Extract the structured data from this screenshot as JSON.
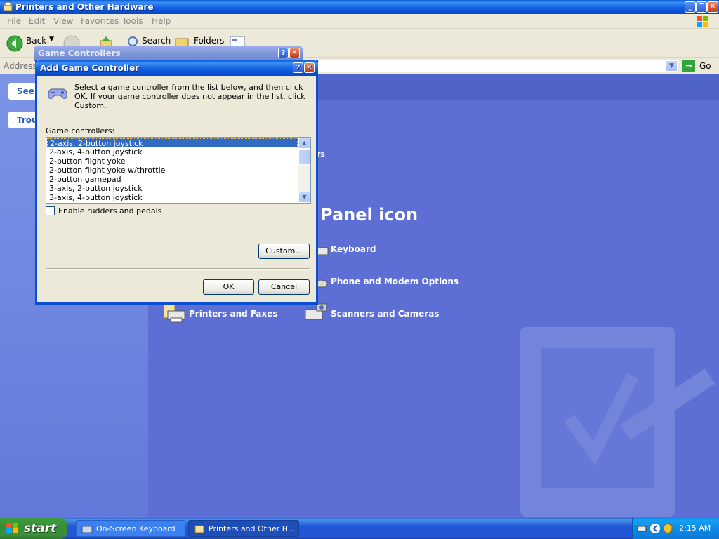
{
  "explorer": {
    "title": "Printers and Other Hardware",
    "menu": [
      "File",
      "Edit",
      "View",
      "Favorites",
      "Tools",
      "Help"
    ],
    "toolbar": {
      "back": "Back",
      "search": "Search",
      "folders": "Folders"
    },
    "address_label": "Address",
    "go_label": "Go"
  },
  "taskpane": {
    "tab1": "See",
    "tab2": "Trou"
  },
  "content": {
    "heading_fragment": "Panel icon",
    "partial_text": "rs",
    "items": [
      "Keyboard",
      "Phone and Modem Options",
      "Printers and Faxes",
      "Scanners and Cameras"
    ]
  },
  "game_controllers": {
    "title": "Game Controllers"
  },
  "add_dialog": {
    "title": "Add Game Controller",
    "instruction": "Select a game controller from the list below, and then click OK.  If your game controller does not appear in the list, click Custom.",
    "list_label": "Game controllers:",
    "list_items": [
      "2-axis, 2-button joystick",
      "2-axis, 4-button joystick",
      "2-button flight yoke",
      "2-button flight yoke w/throttle",
      "2-button gamepad",
      "3-axis, 2-button joystick",
      "3-axis, 4-button joystick"
    ],
    "selected_index": 0,
    "checkbox_label": "Enable rudders and pedals",
    "checkbox_checked": false,
    "custom_button": "Custom...",
    "ok_button": "OK",
    "cancel_button": "Cancel"
  },
  "taskbar": {
    "start": "start",
    "tasks": [
      "On-Screen Keyboard",
      "Printers and Other H..."
    ],
    "time": "2:15 AM"
  },
  "colors": {
    "xp_blue": "#0a5fd8",
    "desktop_panel": "#5d6fd4",
    "selection": "#316ac5"
  }
}
